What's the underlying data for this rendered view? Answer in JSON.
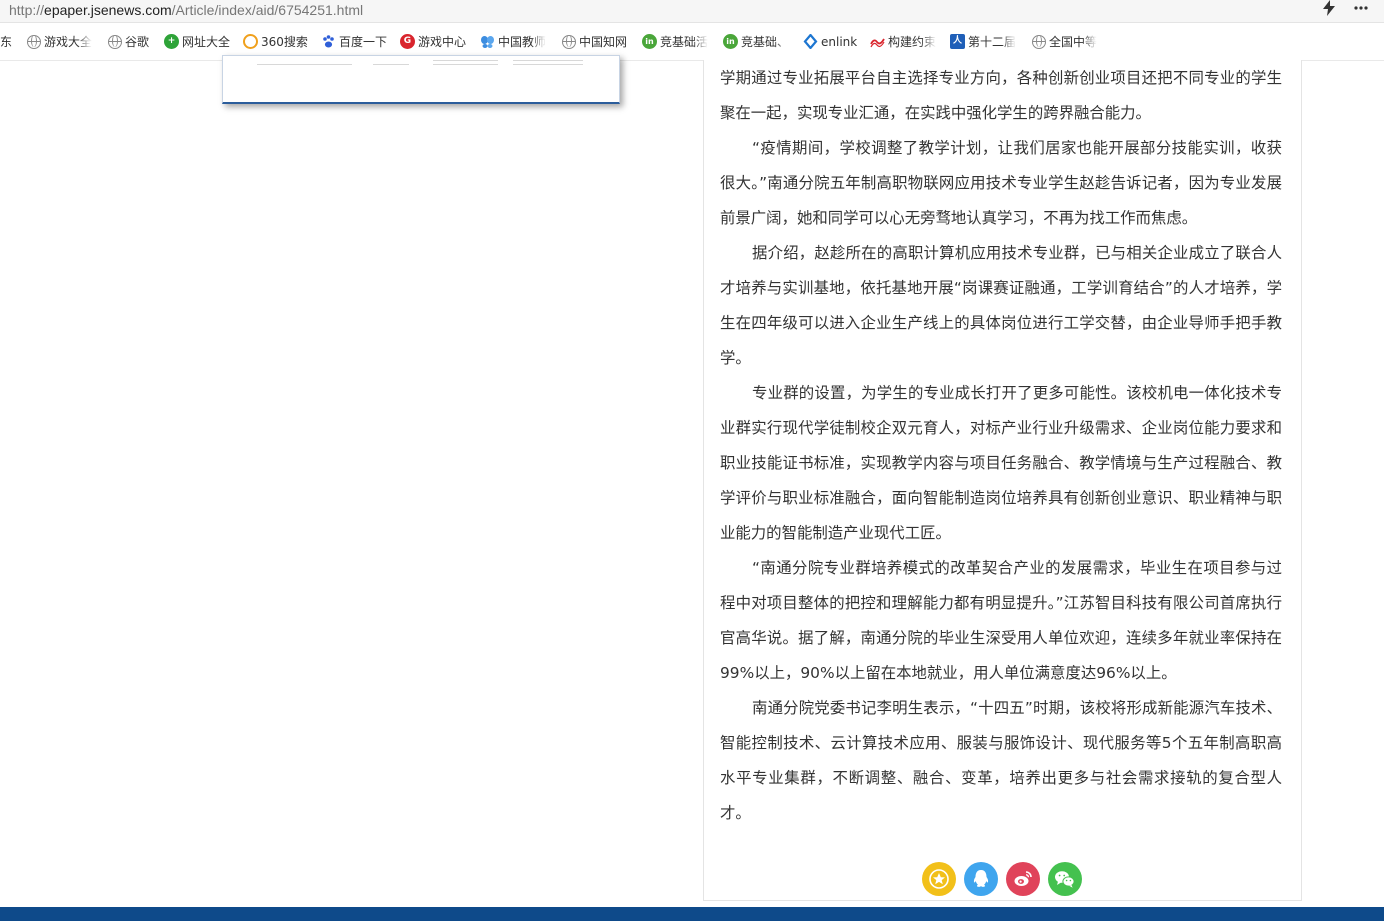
{
  "browser": {
    "url_prefix": "http://",
    "url_host": "epaper.jsenews.com",
    "url_path": "/Article/index/aid/6754251.html",
    "bookmarks": [
      {
        "label": "东",
        "icon": "none"
      },
      {
        "label": "游戏大全",
        "icon": "globe-icon"
      },
      {
        "label": "谷歌",
        "icon": "globe-icon"
      },
      {
        "label": "网址大全",
        "icon": "green-plus-icon"
      },
      {
        "label": "360搜索",
        "icon": "360-search-icon"
      },
      {
        "label": "百度一下",
        "icon": "baidu-paw-icon"
      },
      {
        "label": "游戏中心",
        "icon": "game-center-icon"
      },
      {
        "label": "中国教师",
        "icon": "butterfly-icon"
      },
      {
        "label": "中国知网",
        "icon": "globe-icon"
      },
      {
        "label": "竞基础活",
        "icon": "green-in-icon"
      },
      {
        "label": "竞基础、",
        "icon": "green-in-icon"
      },
      {
        "label": "enlink",
        "icon": "enlink-icon"
      },
      {
        "label": "构建约束",
        "icon": "red-wave-icon"
      },
      {
        "label": "第十二届",
        "icon": "person-icon"
      },
      {
        "label": "全国中等",
        "icon": "globe-icon"
      }
    ]
  },
  "article": {
    "paragraphs": [
      {
        "text": "学期通过专业拓展平台自主选择专业方向，各种创新创业项目还把不同专业的学生聚在一起，实现专业汇通，在实践中强化学生的跨界融合能力。",
        "indent": false
      },
      {
        "text": "“疫情期间，学校调整了教学计划，让我们居家也能开展部分技能实训，收获很大。”南通分院五年制高职物联网应用技术专业学生赵趁告诉记者，因为专业发展前景广阔，她和同学可以心无旁骛地认真学习，不再为找工作而焦虑。",
        "indent": true
      },
      {
        "text": "据介绍，赵趁所在的高职计算机应用技术专业群，已与相关企业成立了联合人才培养与实训基地，依托基地开展“岗课赛证融通，工学训育结合”的人才培养，学生在四年级可以进入企业生产线上的具体岗位进行工学交替，由企业导师手把手教学。",
        "indent": true
      },
      {
        "text": "专业群的设置，为学生的专业成长打开了更多可能性。该校机电一体化技术专业群实行现代学徒制校企双元育人，对标产业行业升级需求、企业岗位能力要求和职业技能证书标准，实现教学内容与项目任务融合、教学情境与生产过程融合、教学评价与职业标准融合，面向智能制造岗位培养具有创新创业意识、职业精神与职业能力的智能制造产业现代工匠。",
        "indent": true
      },
      {
        "text": "“南通分院专业群培养模式的改革契合产业的发展需求，毕业生在项目参与过程中对项目整体的把控和理解能力都有明显提升。”江苏智目科技有限公司首席执行官高华说。据了解，南通分院的毕业生深受用人单位欢迎，连续多年就业率保持在99%以上，90%以上留在本地就业，用人单位满意度达96%以上。",
        "indent": true
      },
      {
        "text": "南通分院党委书记李明生表示，“十四五”时期，该校将形成新能源汽车技术、智能控制技术、云计算技术应用、服装与服饰设计、现代服务等5个五年制高职高水平专业集群，不断调整、融合、变革，培养出更多与社会需求接轨的复合型人才。",
        "indent": true
      }
    ],
    "share_buttons": [
      {
        "name": "favorite",
        "color": "#f2c019"
      },
      {
        "name": "qq",
        "color": "#3fa5ee"
      },
      {
        "name": "weibo",
        "color": "#e0435a"
      },
      {
        "name": "wechat",
        "color": "#44c14f"
      }
    ]
  },
  "colors": {
    "footer_bar": "#0e4a8a",
    "thumbnail_border": "#2b5d9b"
  }
}
